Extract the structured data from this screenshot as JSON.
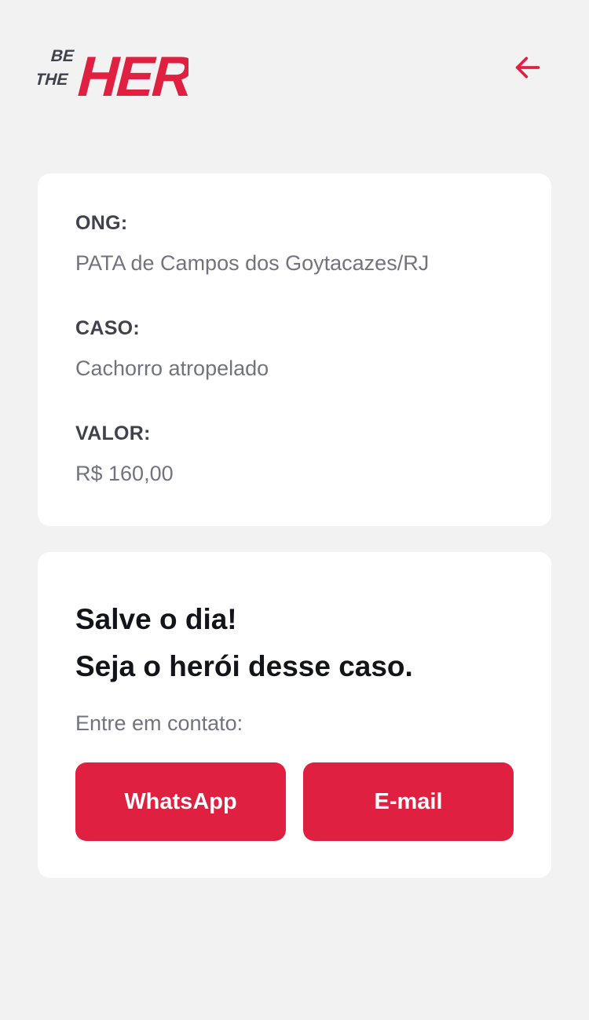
{
  "header": {
    "logo_text": "BE THE HERO",
    "back_icon": "arrow-left-icon"
  },
  "incident": {
    "ong_label": "ONG:",
    "ong_value": "PATA de Campos dos Goytacazes/RJ",
    "case_label": "CASO:",
    "case_value": "Cachorro atropelado",
    "value_label": "VALOR:",
    "value_value": "R$ 160,00"
  },
  "contact": {
    "title_line1": "Salve o dia!",
    "title_line2": "Seja o herói desse caso.",
    "description": "Entre em contato:",
    "whatsapp_label": "WhatsApp",
    "email_label": "E-mail"
  },
  "colors": {
    "accent": "#e02041",
    "background": "#f2f2f2",
    "card": "#ffffff",
    "label": "#41414d",
    "value": "#737380"
  }
}
